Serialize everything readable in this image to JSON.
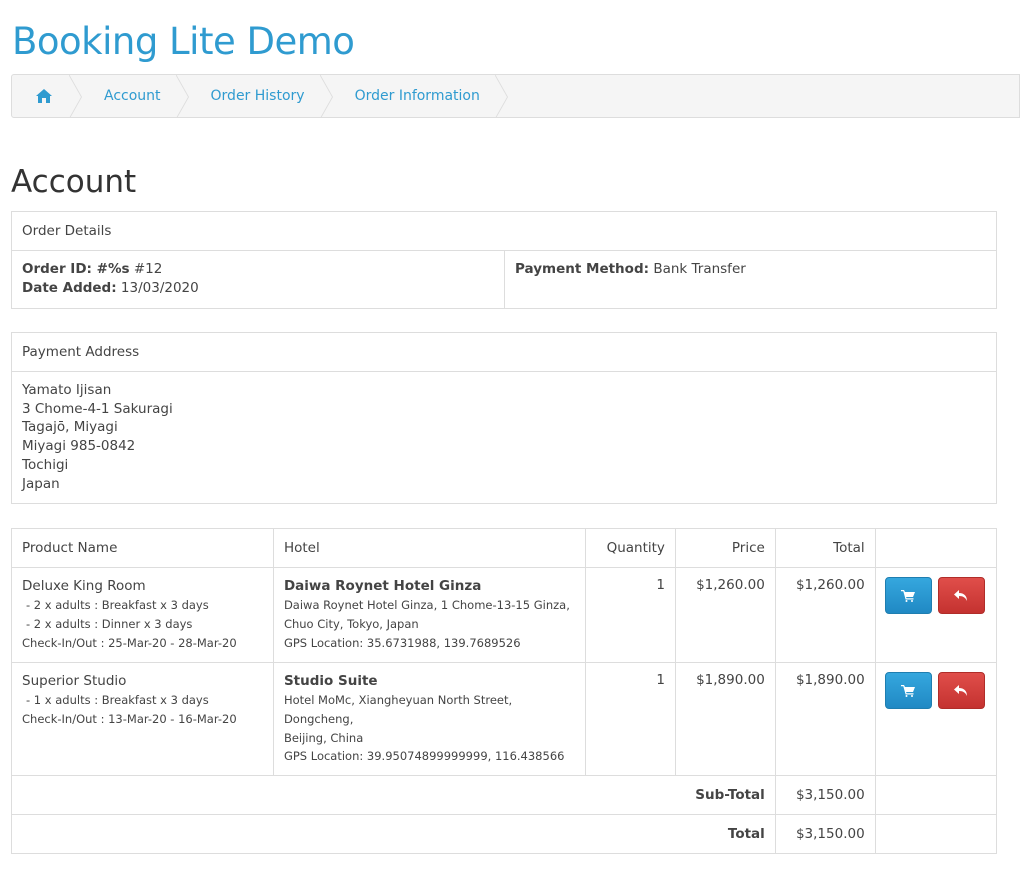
{
  "site": {
    "title": "Booking Lite Demo"
  },
  "breadcrumb": {
    "home_icon": "home-icon",
    "items": [
      "Account",
      "Order History",
      "Order Information"
    ]
  },
  "page": {
    "heading": "Account"
  },
  "order_details": {
    "heading": "Order Details",
    "order_id_label": "Order ID: #%s",
    "order_id_value": "#12",
    "date_added_label": "Date Added:",
    "date_added_value": "13/03/2020",
    "payment_method_label": "Payment Method:",
    "payment_method_value": "Bank Transfer"
  },
  "payment_address": {
    "heading": "Payment Address",
    "lines": [
      "Yamato Ijisan",
      "3 Chome-4-1 Sakuragi",
      "Tagajō, Miyagi",
      "Miyagi 985-0842",
      "Tochigi",
      "Japan"
    ]
  },
  "products_table": {
    "headers": [
      "Product Name",
      "Hotel",
      "Quantity",
      "Price",
      "Total",
      ""
    ],
    "rows": [
      {
        "product": "Deluxe King Room",
        "options": [
          "- 2 x adults : Breakfast x 3 days",
          "- 2 x adults : Dinner x 3 days"
        ],
        "checkin": "Check-In/Out : 25-Mar-20 - 28-Mar-20",
        "hotel_name": "Daiwa Roynet Hotel Ginza",
        "hotel_address": [
          "Daiwa Roynet Hotel Ginza, 1 Chome-13-15 Ginza,",
          "Chuo City, Tokyo, Japan"
        ],
        "gps": "GPS Location: 35.6731988, 139.7689526",
        "quantity": "1",
        "price": "$1,260.00",
        "total": "$1,260.00"
      },
      {
        "product": "Superior Studio",
        "options": [
          "- 1 x adults : Breakfast x 3 days"
        ],
        "checkin": "Check-In/Out : 13-Mar-20 - 16-Mar-20",
        "hotel_name": "Studio Suite",
        "hotel_address": [
          "Hotel MoMc, Xiangheyuan North Street, Dongcheng,",
          "Beijing, China"
        ],
        "gps": "GPS Location: 39.95074899999999, 116.438566",
        "quantity": "1",
        "price": "$1,890.00",
        "total": "$1,890.00"
      }
    ],
    "subtotal_label": "Sub-Total",
    "subtotal_value": "$3,150.00",
    "total_label": "Total",
    "total_value": "$3,150.00",
    "reorder_icon": "shopping-cart-icon",
    "return_icon": "reply-icon",
    "colors": {
      "reorder": "#2a9fd6",
      "return": "#d9433f",
      "link": "#2f9bd0"
    }
  }
}
